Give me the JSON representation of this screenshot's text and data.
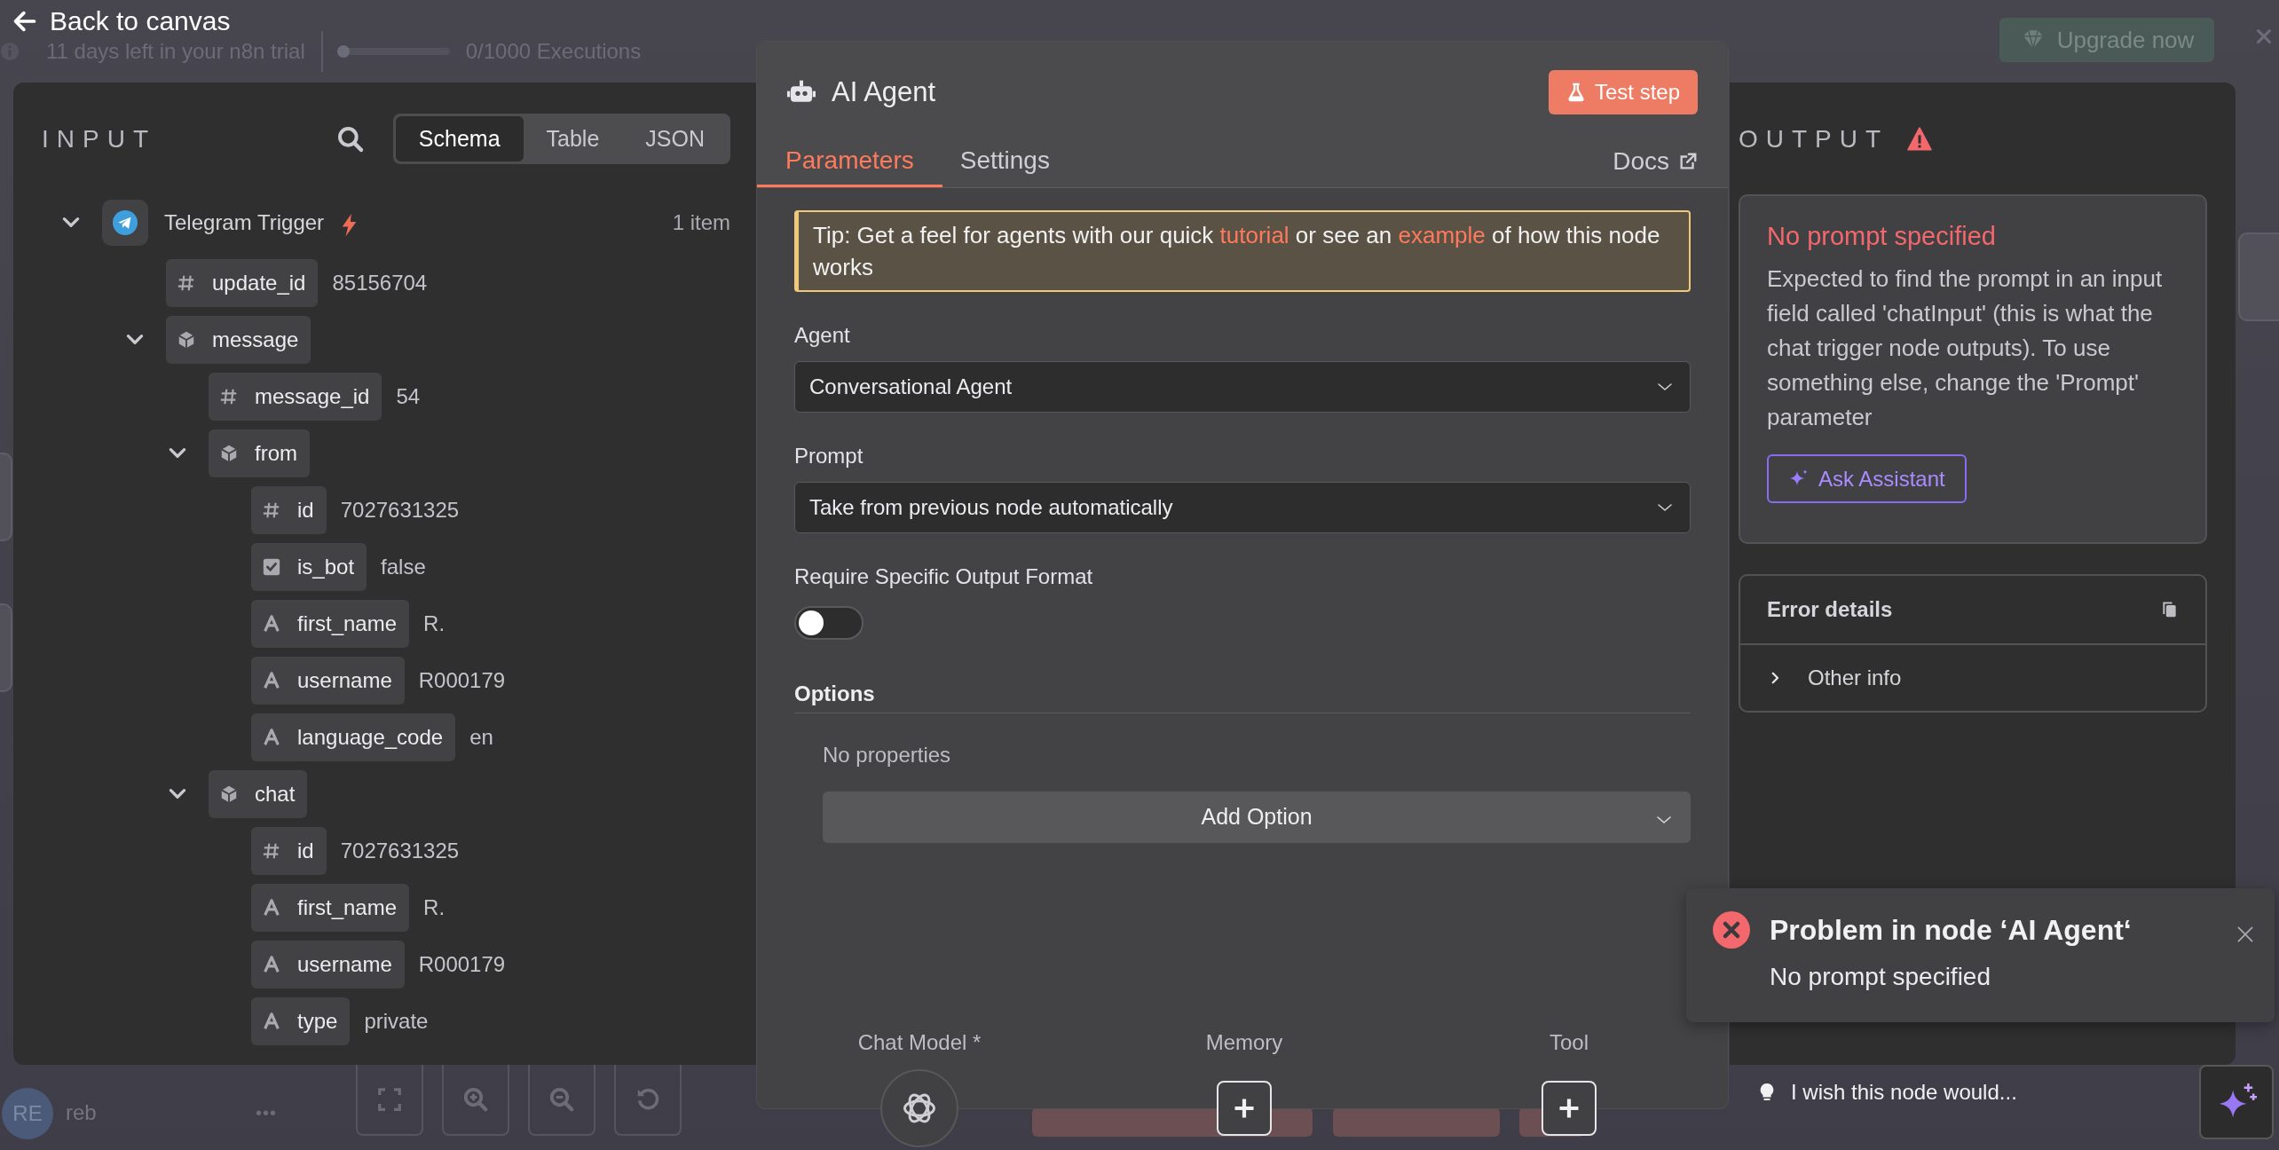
{
  "top_bar": {
    "back": "Back to canvas",
    "trial": "11 days left in your n8n trial",
    "executions": {
      "level": 0,
      "label": "0/1000 Executions"
    },
    "upgrade": "Upgrade now"
  },
  "input": {
    "title": "INPUT",
    "views": [
      {
        "label": "Schema",
        "selected": true
      },
      {
        "label": "Table",
        "selected": false
      },
      {
        "label": "JSON",
        "selected": false
      }
    ],
    "trigger": {
      "name": "Telegram Trigger",
      "count": "1 item",
      "expanded": true,
      "children": [
        {
          "kind": "number",
          "key": "update_id",
          "value": "85156704"
        },
        {
          "kind": "object",
          "key": "message",
          "expanded": true,
          "children": [
            {
              "kind": "number",
              "key": "message_id",
              "value": "54"
            },
            {
              "kind": "object",
              "key": "from",
              "expanded": true,
              "children": [
                {
                  "kind": "number",
                  "key": "id",
                  "value": "7027631325"
                },
                {
                  "kind": "boolean",
                  "key": "is_bot",
                  "value": "false"
                },
                {
                  "kind": "string",
                  "key": "first_name",
                  "value": "R."
                },
                {
                  "kind": "string",
                  "key": "username",
                  "value": "R000179"
                },
                {
                  "kind": "string",
                  "key": "language_code",
                  "value": "en"
                }
              ]
            },
            {
              "kind": "object",
              "key": "chat",
              "expanded": true,
              "children": [
                {
                  "kind": "number",
                  "key": "id",
                  "value": "7027631325"
                },
                {
                  "kind": "string",
                  "key": "first_name",
                  "value": "R."
                },
                {
                  "kind": "string",
                  "key": "username",
                  "value": "R000179"
                },
                {
                  "kind": "string",
                  "key": "type",
                  "value": "private"
                }
              ]
            }
          ]
        }
      ]
    }
  },
  "node": {
    "title": "AI Agent",
    "test_button": "Test step",
    "tabs": [
      {
        "label": "Parameters",
        "selected": true
      },
      {
        "label": "Settings",
        "selected": false
      }
    ],
    "docs": "Docs",
    "tip": [
      {
        "text": "Tip: Get a feel for agents with our quick "
      },
      {
        "text": "tutorial",
        "kind": "link"
      },
      {
        "text": " or see an "
      },
      {
        "text": "example",
        "kind": "link"
      },
      {
        "text": " of how this node works"
      }
    ],
    "fields": [
      {
        "kind": "select",
        "label": "Agent",
        "value": "Conversational Agent"
      },
      {
        "kind": "select",
        "label": "Prompt",
        "value": "Take from previous node automatically"
      },
      {
        "kind": "toggle",
        "label": "Require Specific Output Format",
        "on": false
      }
    ],
    "options": {
      "title": "Options",
      "empty": "No properties",
      "add": "Add Option"
    },
    "sub_nodes": [
      {
        "label": "Chat Model *",
        "kind": "connected"
      },
      {
        "label": "Memory",
        "kind": "empty"
      },
      {
        "label": "Tool",
        "kind": "empty"
      }
    ]
  },
  "output": {
    "title": "OUTPUT",
    "error": {
      "title": "No prompt specified",
      "message": "Expected to find the prompt in an input field called 'chatInput' (this is what the chat trigger node outputs). To use something else, change the 'Prompt' parameter",
      "button": "Ask Assistant"
    },
    "details": {
      "title": "Error details",
      "rows": [
        {
          "label": "Other info",
          "expanded": false
        }
      ]
    }
  },
  "toast": {
    "title": "Problem in node ‘AI Agent‘",
    "message": "No prompt specified"
  },
  "feedback": "I wish this node would...",
  "user": {
    "initials": "RE",
    "name": "reb",
    "menu": "•••"
  }
}
